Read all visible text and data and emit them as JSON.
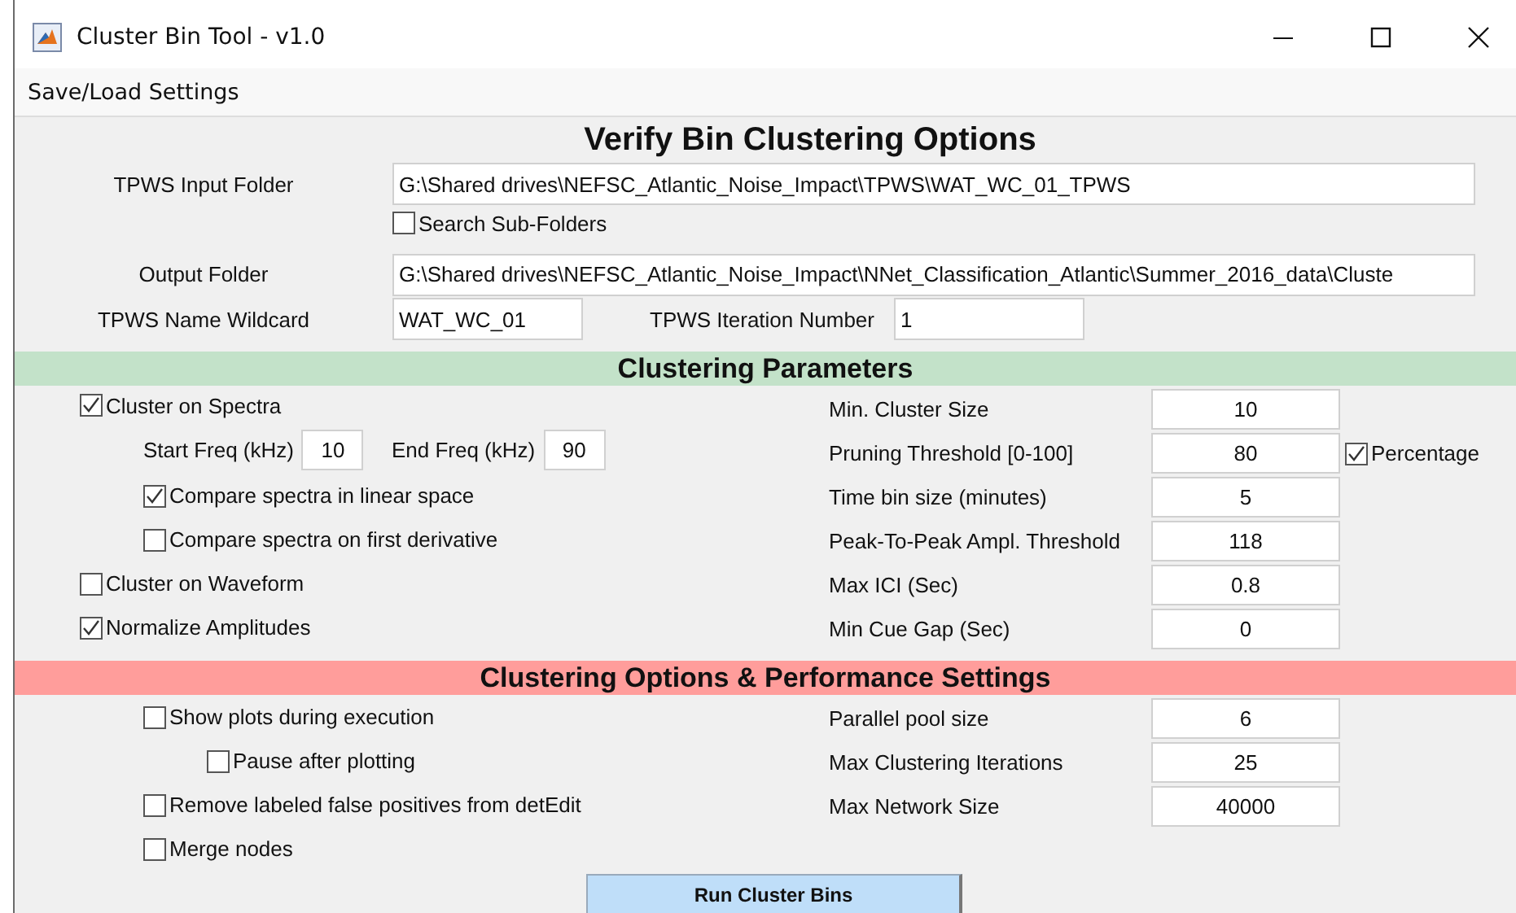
{
  "window": {
    "title": "Cluster Bin Tool - v1.0"
  },
  "menu": [
    {
      "label": "Save/Load Settings"
    }
  ],
  "heading": "Verify Bin Clustering Options",
  "input_folder": {
    "label": "TPWS Input Folder",
    "value": "G:\\Shared drives\\NEFSC_Atlantic_Noise_Impact\\TPWS\\WAT_WC_01_TPWS"
  },
  "search_subfolders": {
    "label": "Search Sub-Folders",
    "checked": false
  },
  "output_folder": {
    "label": "Output Folder",
    "value": "G:\\Shared drives\\NEFSC_Atlantic_Noise_Impact\\NNet_Classification_Atlantic\\Summer_2016_data\\Cluste"
  },
  "name_wildcard": {
    "label": "TPWS Name Wildcard",
    "value": "WAT_WC_01"
  },
  "iteration_number": {
    "label": "TPWS Iteration Number",
    "value": "1"
  },
  "sections": [
    {
      "title": "Clustering Parameters",
      "color": "#c3e2c9",
      "options": [
        {
          "kind": "checkbox",
          "label": "Cluster on Spectra",
          "checked": true,
          "children": [
            {
              "kind": "range",
              "fields": [
                {
                  "label": "Start Freq (kHz)",
                  "value": "10"
                },
                {
                  "label": "End Freq (kHz)",
                  "value": "90"
                }
              ]
            },
            {
              "kind": "checkbox",
              "label": "Compare spectra in linear space",
              "checked": true
            },
            {
              "kind": "checkbox",
              "label": "Compare spectra on first derivative",
              "checked": false
            }
          ]
        },
        {
          "kind": "checkbox",
          "label": "Cluster on Waveform",
          "checked": false
        },
        {
          "kind": "checkbox",
          "label": "Normalize Amplitudes",
          "checked": true
        }
      ],
      "parameters": [
        {
          "label": "Min. Cluster Size",
          "value": "10"
        },
        {
          "label": "Pruning Threshold [0-100]",
          "value": "80",
          "toggle": {
            "label": "Percentage",
            "checked": true
          }
        },
        {
          "label": "Time bin size (minutes)",
          "value": "5"
        },
        {
          "label": "Peak-To-Peak Ampl. Threshold",
          "value": "118"
        },
        {
          "label": "Max ICI (Sec)",
          "value": "0.8"
        },
        {
          "label": "Min Cue Gap (Sec)",
          "value": "0"
        }
      ]
    },
    {
      "title": "Clustering Options & Performance Settings",
      "color": "#ff9d9b",
      "options": [
        {
          "kind": "checkbox",
          "label": "Show plots during execution",
          "checked": false,
          "children": [
            {
              "kind": "checkbox",
              "label": "Pause after plotting",
              "checked": false
            }
          ]
        },
        {
          "kind": "checkbox",
          "label": "Remove labeled false positives from detEdit",
          "checked": false
        },
        {
          "kind": "checkbox",
          "label": "Merge nodes",
          "checked": false
        }
      ],
      "parameters": [
        {
          "label": "Parallel pool size",
          "value": "6"
        },
        {
          "label": "Max Clustering Iterations",
          "value": "25"
        },
        {
          "label": "Max Network Size",
          "value": "40000"
        }
      ]
    }
  ],
  "run_button": {
    "label": "Run Cluster Bins"
  }
}
